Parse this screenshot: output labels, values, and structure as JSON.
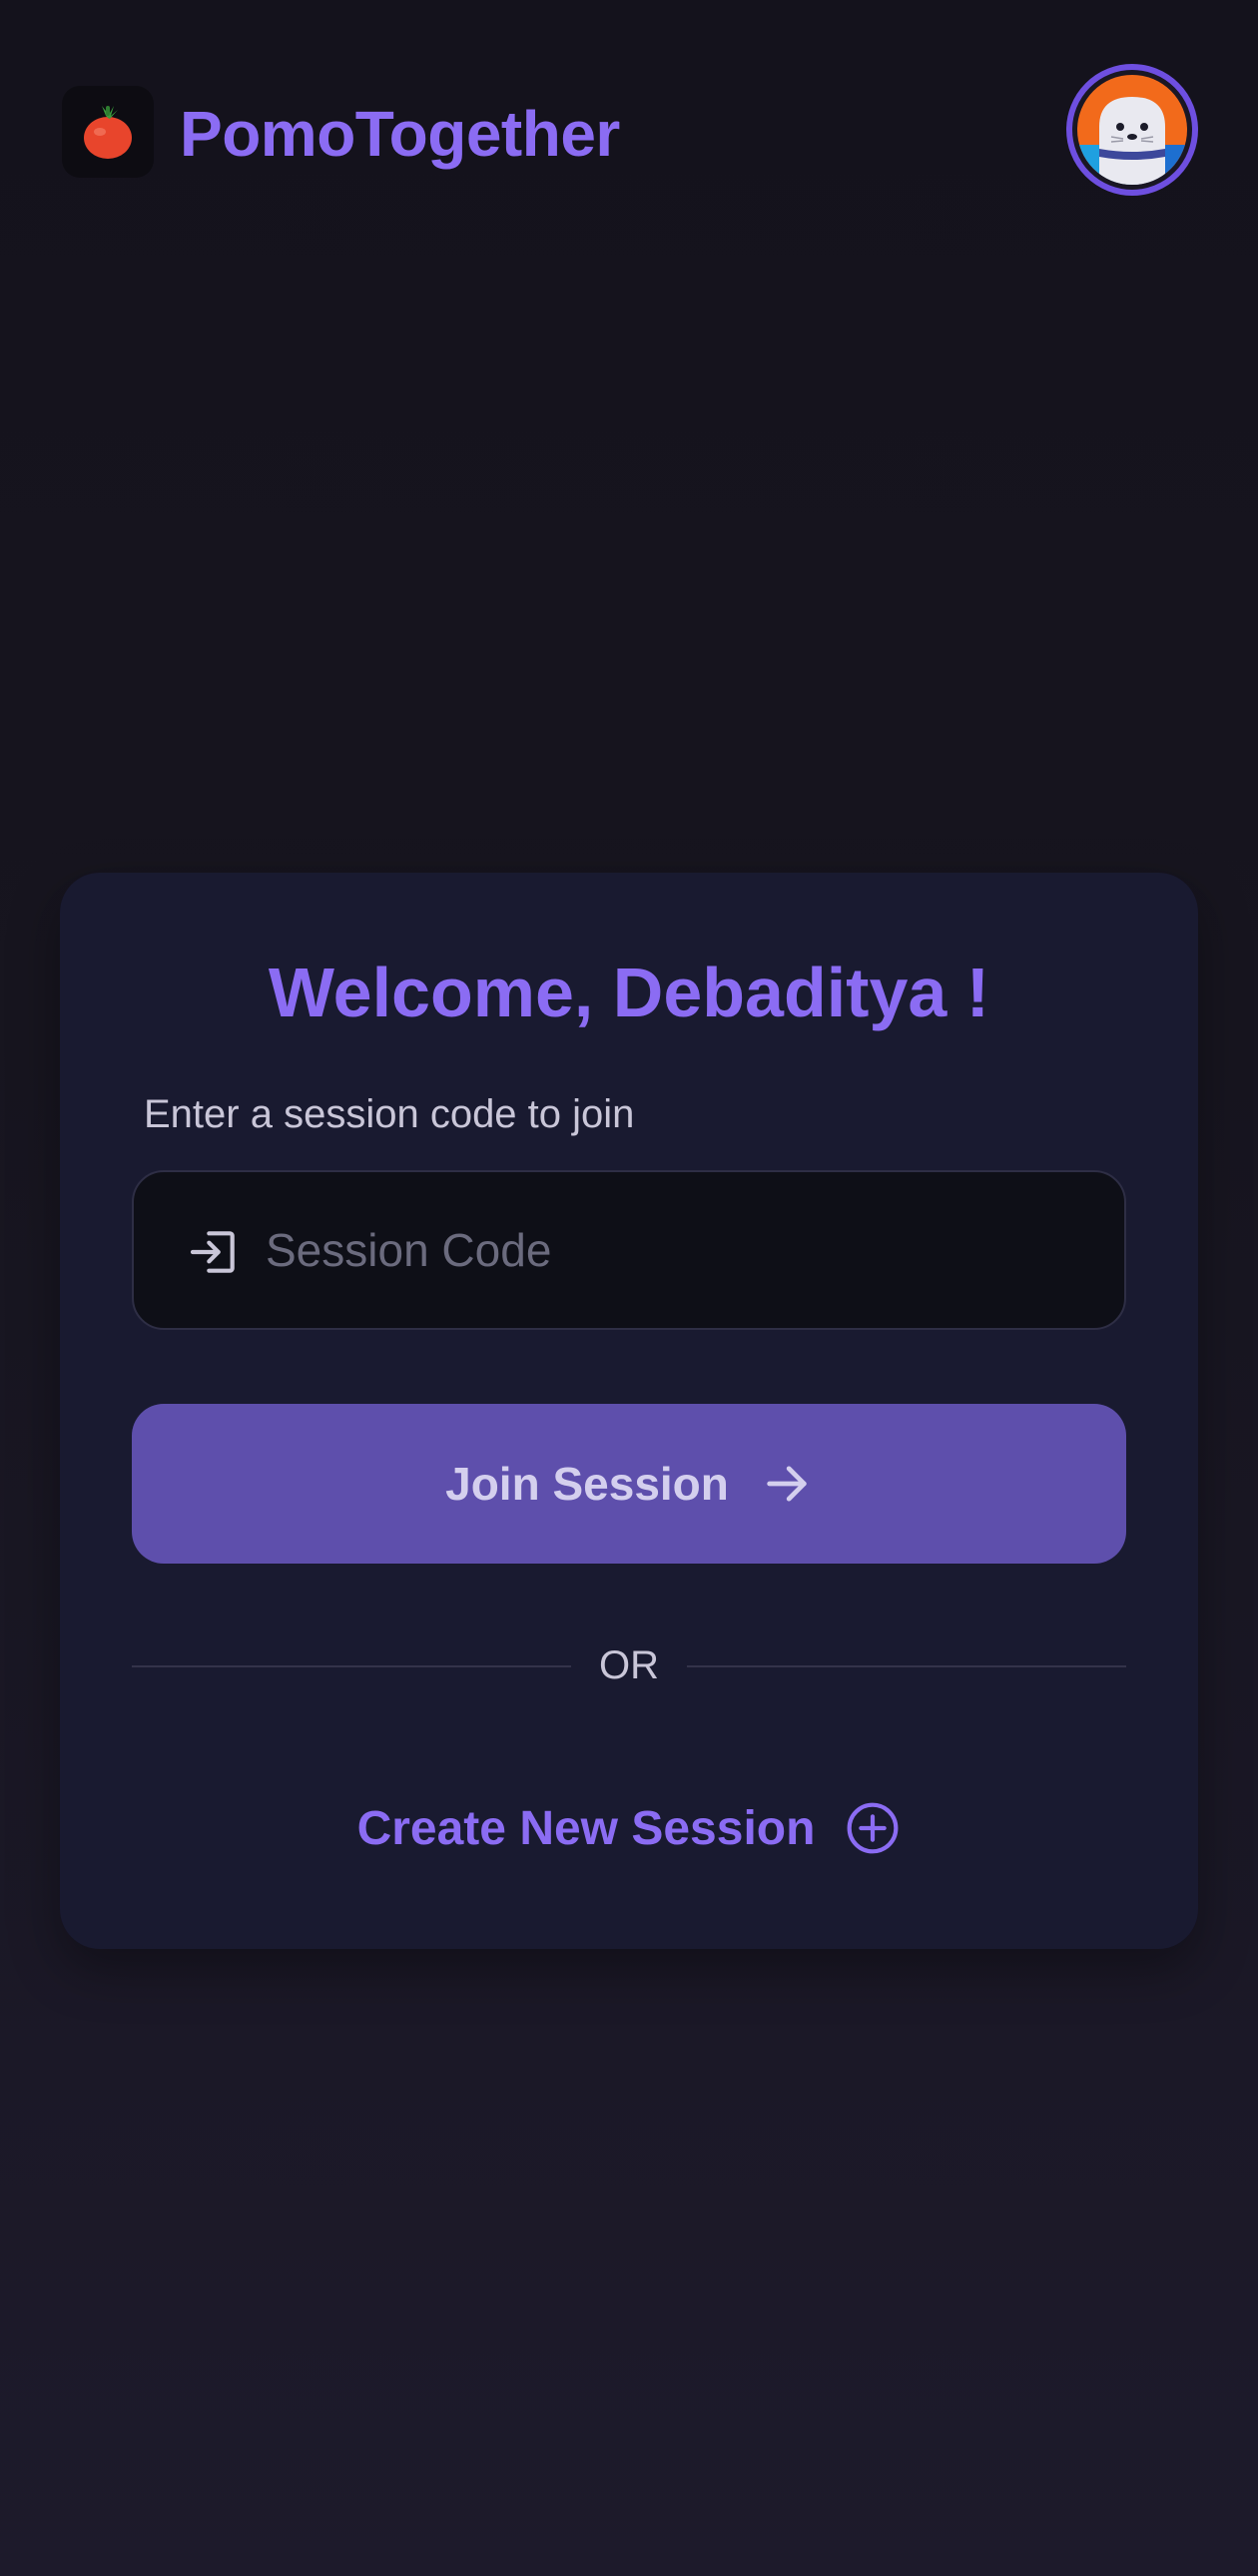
{
  "app": {
    "title": "PomoTogether",
    "logo_icon": "tomato-icon"
  },
  "header": {
    "avatar_icon": "seal-avatar-icon"
  },
  "card": {
    "welcome": "Welcome, Debaditya !",
    "session_label": "Enter a session code to join",
    "session_input": {
      "value": "",
      "placeholder": "Session Code",
      "icon": "login-icon"
    },
    "join_button": {
      "label": "Join Session",
      "icon": "arrow-right-icon"
    },
    "divider_text": "OR",
    "create_button": {
      "label": "Create New Session",
      "icon": "plus-circle-icon"
    }
  },
  "colors": {
    "accent": "#8b6cf3",
    "button": "#5e4fac",
    "card_bg": "#191a30",
    "page_bg": "#14121c"
  }
}
